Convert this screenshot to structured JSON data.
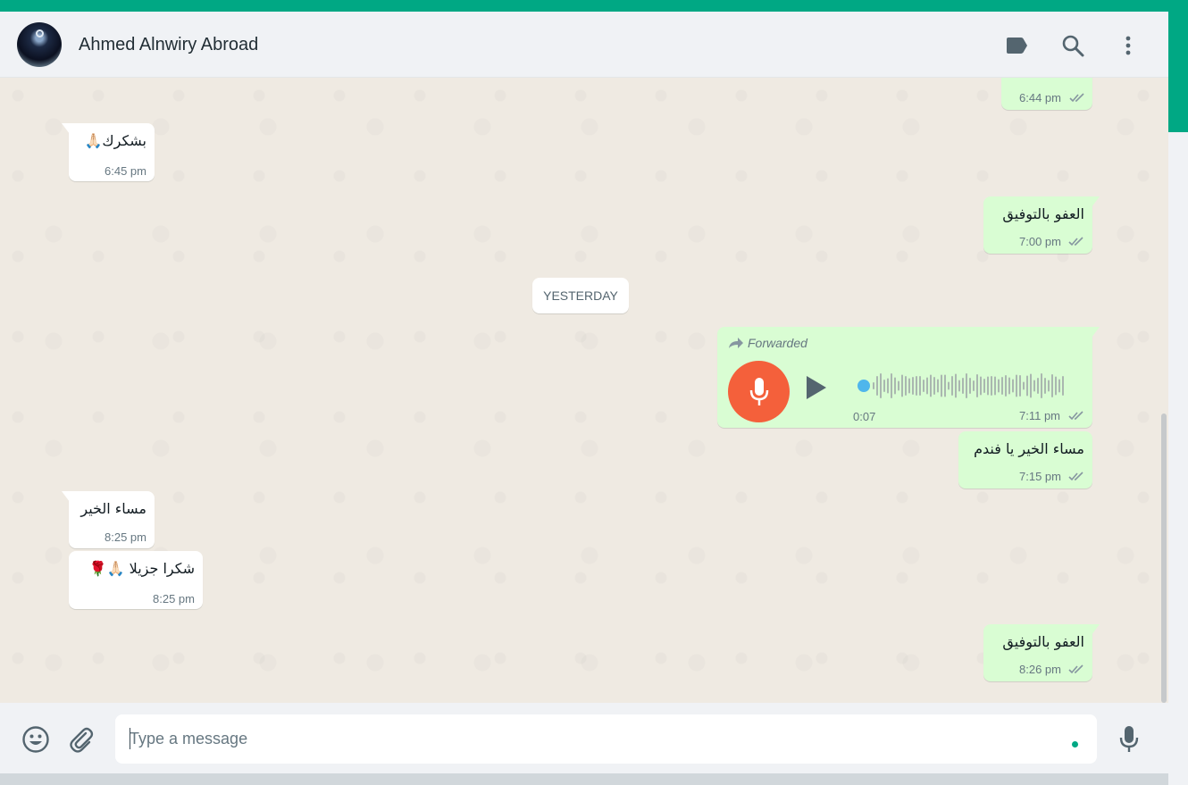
{
  "header": {
    "contact_name": "Ahmed Alnwiry Abroad",
    "icons": [
      "label-icon",
      "search-icon",
      "more-options-icon"
    ]
  },
  "chat": {
    "date_divider": "YESTERDAY",
    "messages": [
      {
        "direction": "out",
        "text": "",
        "time": "6:44 pm",
        "status": "read"
      },
      {
        "direction": "in",
        "text": "بشكرك🙏🏻",
        "time": "6:45 pm"
      },
      {
        "direction": "out",
        "text": "العفو بالتوفيق",
        "time": "7:00 pm",
        "status": "read"
      },
      {
        "direction": "out",
        "type": "voice",
        "forwarded_label": "Forwarded",
        "duration": "0:07",
        "time": "7:11 pm",
        "status": "read"
      },
      {
        "direction": "out",
        "text": "مساء الخير يا فندم",
        "time": "7:15 pm",
        "status": "read"
      },
      {
        "direction": "in",
        "text": "مساء الخير",
        "time": "8:25 pm"
      },
      {
        "direction": "in",
        "text": "شكرا جزيلا 🙏🏻🌹",
        "time": "8:25 pm"
      },
      {
        "direction": "out",
        "text": "العفو بالتوفيق",
        "time": "8:26 pm",
        "status": "read"
      }
    ]
  },
  "composer": {
    "placeholder": "Type a message",
    "icons": [
      "emoji-icon",
      "attach-icon",
      "microphone-icon"
    ]
  },
  "colors": {
    "accent": "#00a884",
    "outgoing_bubble": "#d9fdd3",
    "incoming_bubble": "#ffffff",
    "voice_avatar": "#f4603b",
    "chat_background": "#efeae2"
  }
}
